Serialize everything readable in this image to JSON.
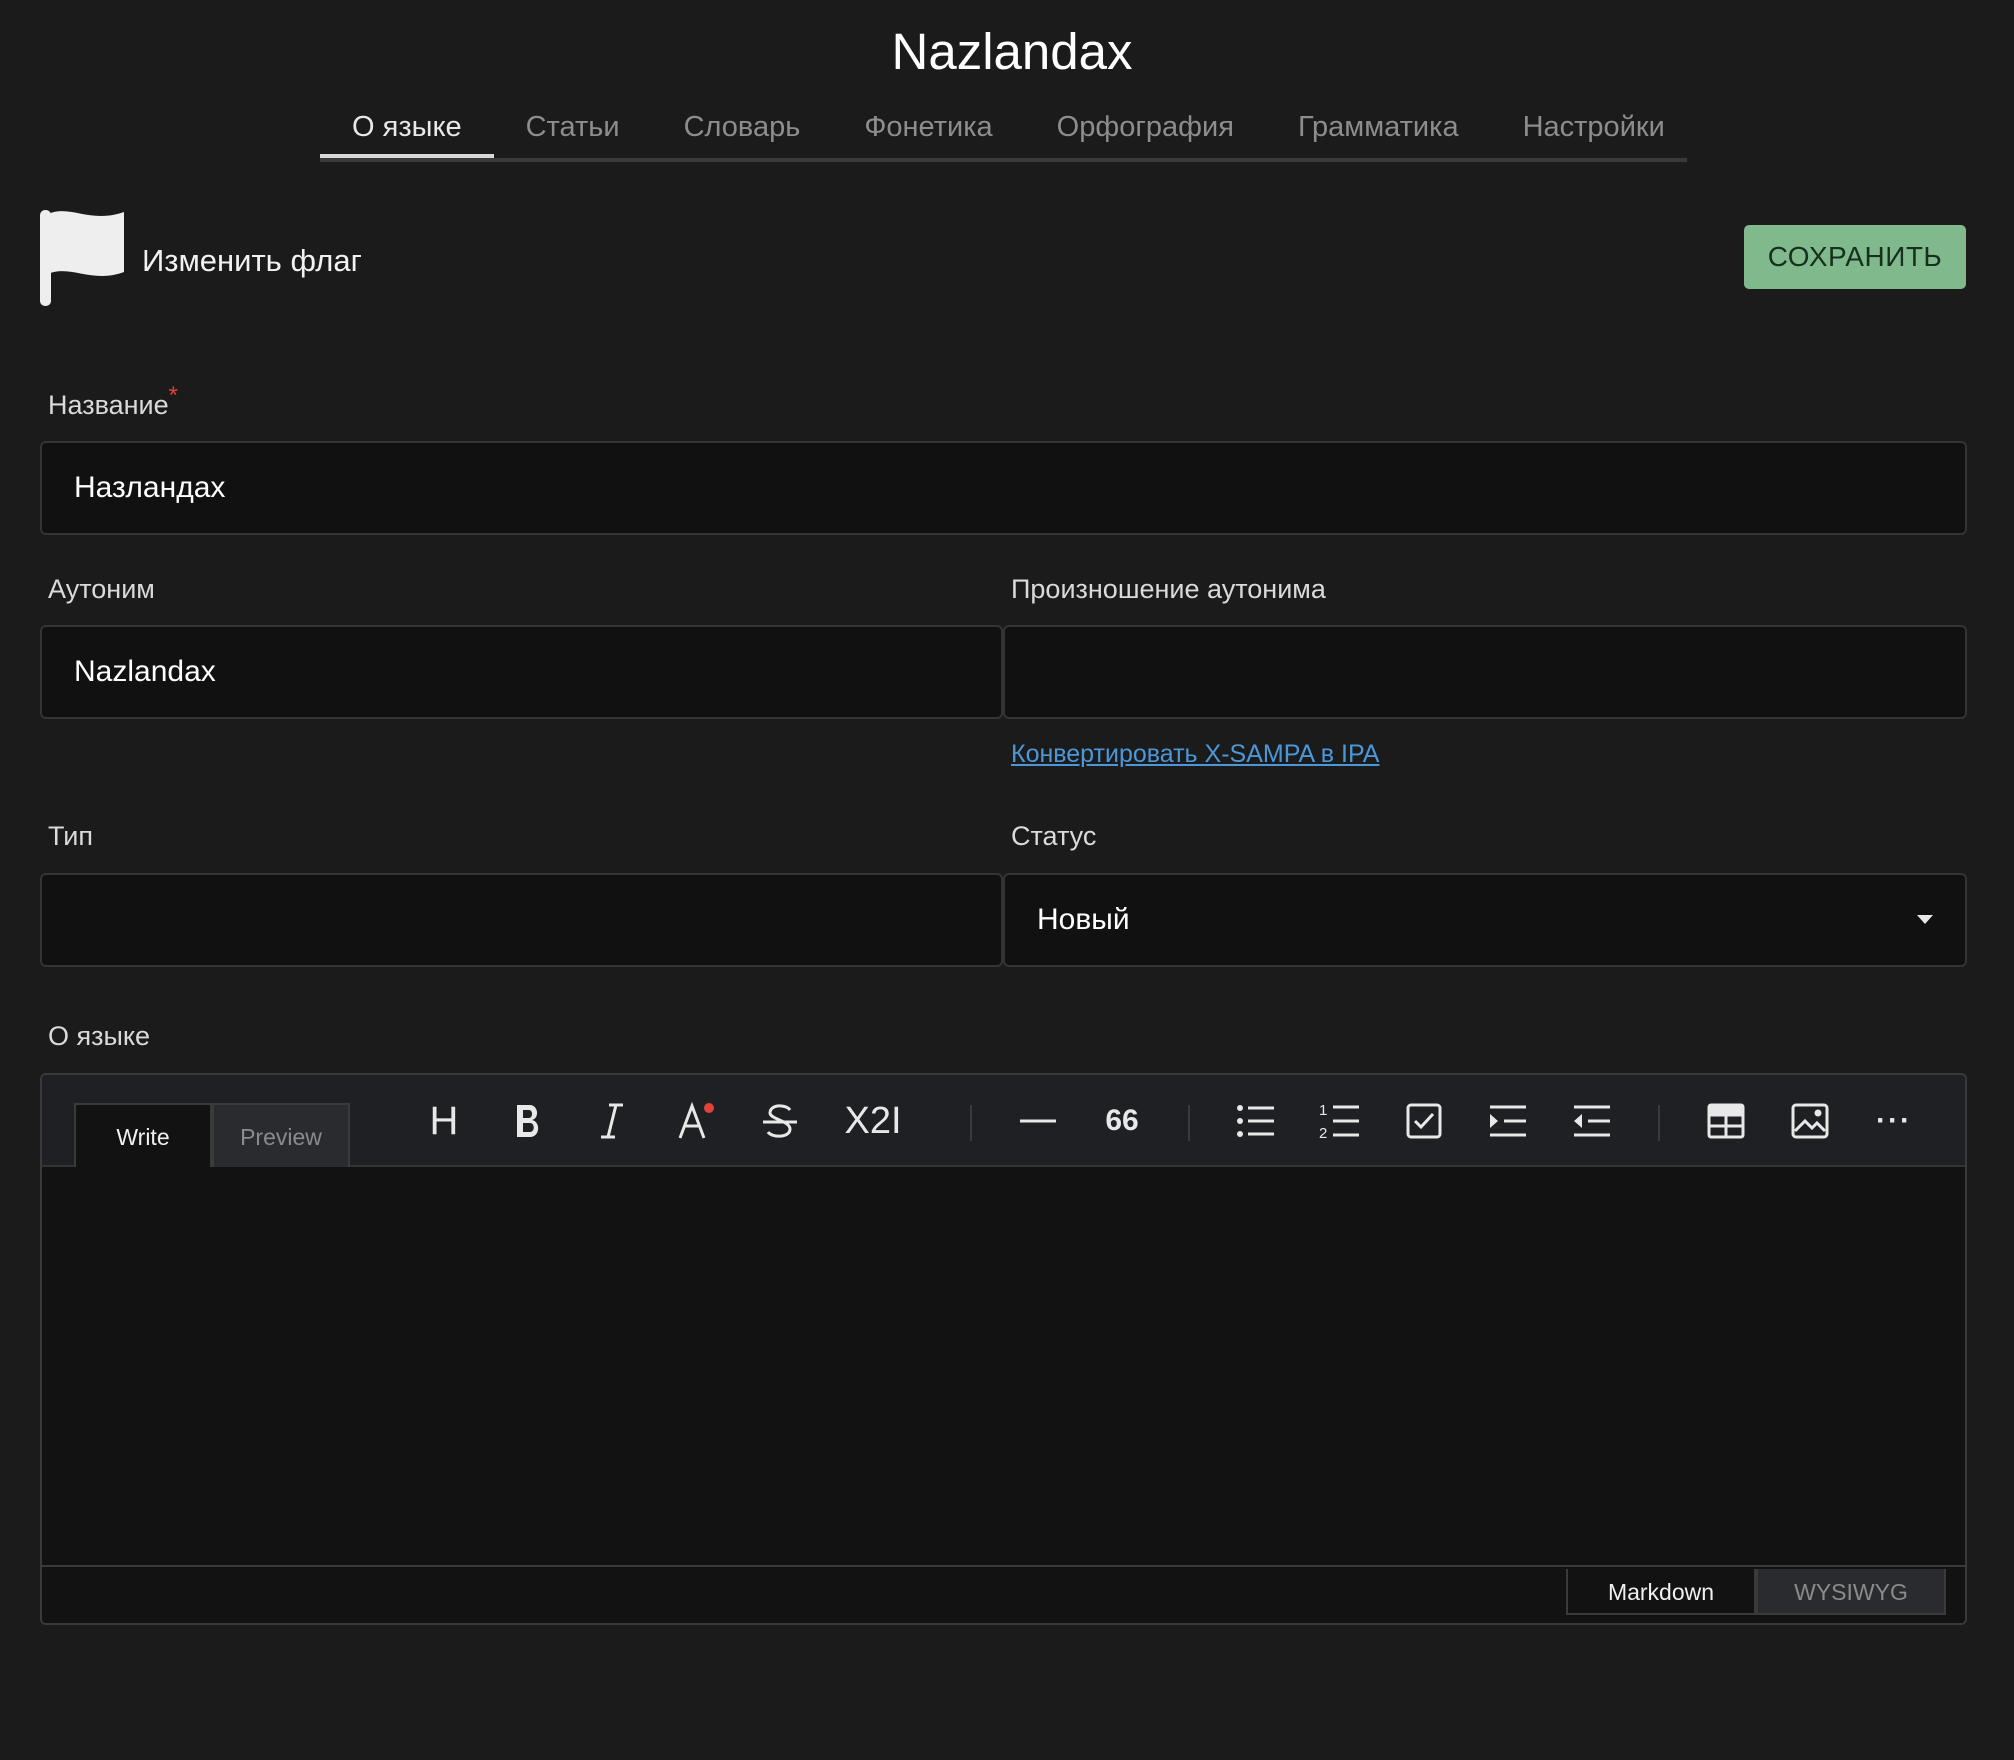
{
  "page": {
    "title": "Nazlandax"
  },
  "tabs": [
    {
      "label": "О языке",
      "active": true
    },
    {
      "label": "Статьи"
    },
    {
      "label": "Словарь"
    },
    {
      "label": "Фонетика"
    },
    {
      "label": "Орфография"
    },
    {
      "label": "Грамматика"
    },
    {
      "label": "Настройки"
    }
  ],
  "flag": {
    "label": "Изменить флаг",
    "icon": "flag-icon"
  },
  "save_button": {
    "label": "СОХРАНИТЬ",
    "color": "#7fb98c"
  },
  "form": {
    "name": {
      "label": "Название",
      "required_mark": "*",
      "value": "Назландах"
    },
    "autonym": {
      "label": "Аутоним",
      "value": "Nazlandax"
    },
    "autonym_pronunciation": {
      "label": "Произношение аутонима",
      "value": ""
    },
    "convert_link": "Конвертировать X-SAMPA в IPA",
    "type": {
      "label": "Тип",
      "value": ""
    },
    "status": {
      "label": "Статус",
      "value": "Новый"
    },
    "about": {
      "label": "О языке"
    }
  },
  "editor": {
    "tabs": {
      "write": "Write",
      "preview": "Preview"
    },
    "modes": {
      "markdown": "Markdown",
      "wysiwyg": "WYSIWYG"
    },
    "toolbar": {
      "heading": "H",
      "subsup": "X2I",
      "quote": "66",
      "more": "···"
    },
    "content": ""
  },
  "colors": {
    "accent": "#7fb98c",
    "link": "#4c97d8",
    "required": "#e0433a",
    "background": "#1b1b1b"
  }
}
